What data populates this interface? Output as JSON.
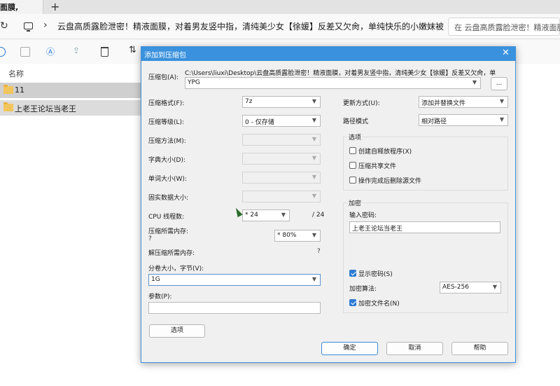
{
  "browser": {
    "active_tab_label": "面膜,",
    "new_tab_symbol": "+",
    "close_symbol": "✕"
  },
  "address_bar": {
    "refresh_symbol": "↻",
    "chevron": "›",
    "path": "云盘高质露脸泄密！精液面膜，对着男友竖中指，清纯美少女【徐媛】反差又欠肏，单纯快乐的小嫩妹被男",
    "search_placeholder": "在 云盘高质露脸泄密！精液面膜"
  },
  "explorer": {
    "column_name": "名称",
    "items": [
      {
        "label": "11"
      },
      {
        "label": "上老王论坛当老王"
      }
    ],
    "toolbar_sort_symbol": "⇅"
  },
  "dialog": {
    "title": "添加到压缩包",
    "close_symbol": "✕",
    "archive": {
      "label": "压缩包(A):",
      "path": "C:\\Users\\liuxi\\Desktop\\云盘高质露脸泄密！精液面膜，对着男友竖中指，清纯美少女【徐媛】反差又欠肏，单",
      "name_value": "YPG",
      "browse_label": "..."
    },
    "format": {
      "label": "压缩格式(F):",
      "value": "7z"
    },
    "level": {
      "label": "压缩等级(L):",
      "value": "0 - 仅存储"
    },
    "method": {
      "label": "压缩方法(M):",
      "value": ""
    },
    "dict_size": {
      "label": "字典大小(D):",
      "value": ""
    },
    "word_size": {
      "label": "单词大小(W):",
      "value": ""
    },
    "solid_size": {
      "label": "固实数据大小:",
      "value": ""
    },
    "cpu_threads": {
      "label": "CPU 线程数:",
      "value": "* 24",
      "max": "/ 24"
    },
    "memory_compress": {
      "label": "压缩所需内存:",
      "value": "* 80%",
      "unknown": "?"
    },
    "memory_decompress": {
      "label": "解压缩所需内存:",
      "unknown": "?"
    },
    "volume": {
      "label": "分卷大小，字节(V):",
      "value": "1G"
    },
    "params": {
      "label": "参数(P):",
      "value": ""
    },
    "options_button": "选项",
    "update_mode": {
      "label": "更新方式(U):",
      "value": "添加并替换文件"
    },
    "path_mode": {
      "label": "路径模式",
      "value": "相对路径"
    },
    "options_group": {
      "title": "选项",
      "checkboxes": [
        {
          "label": "创建自释放程序(X)",
          "checked": false
        },
        {
          "label": "压缩共享文件",
          "checked": false
        },
        {
          "label": "操作完成后删除源文件",
          "checked": false
        }
      ]
    },
    "encryption": {
      "title": "加密",
      "password_label": "输入密码:",
      "password_value": "上老王论坛当老王",
      "show_password": {
        "label": "显示密码(S)",
        "checked": true
      },
      "method_label": "加密算法:",
      "method_value": "AES-256",
      "encrypt_names": {
        "label": "加密文件名(N)",
        "checked": true
      }
    },
    "buttons": {
      "ok": "确定",
      "cancel": "取消",
      "help": "帮助"
    }
  },
  "colors": {
    "title_bar": "#3a91dd",
    "accent": "#2f7bd3",
    "folder": "#f2c55c"
  }
}
